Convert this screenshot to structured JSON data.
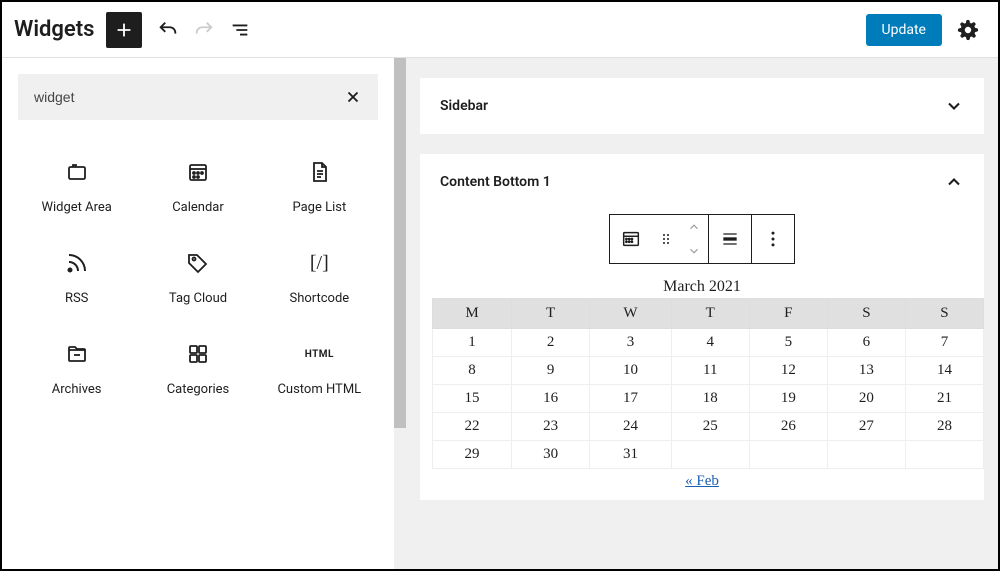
{
  "header": {
    "title": "Widgets",
    "update_label": "Update"
  },
  "search": {
    "value": "widget"
  },
  "blocks": [
    {
      "label": "Widget Area",
      "icon": "widget-area"
    },
    {
      "label": "Calendar",
      "icon": "calendar"
    },
    {
      "label": "Page List",
      "icon": "page-list"
    },
    {
      "label": "RSS",
      "icon": "rss"
    },
    {
      "label": "Tag Cloud",
      "icon": "tag"
    },
    {
      "label": "Shortcode",
      "icon": "shortcode"
    },
    {
      "label": "Archives",
      "icon": "archives"
    },
    {
      "label": "Categories",
      "icon": "categories"
    },
    {
      "label": "Custom HTML",
      "icon": "html"
    }
  ],
  "areas": {
    "sidebar": {
      "title": "Sidebar"
    },
    "content_bottom": {
      "title": "Content Bottom 1"
    }
  },
  "calendar": {
    "caption": "March 2021",
    "days": [
      "M",
      "T",
      "W",
      "T",
      "F",
      "S",
      "S"
    ],
    "weeks": [
      [
        "1",
        "2",
        "3",
        "4",
        "5",
        "6",
        "7"
      ],
      [
        "8",
        "9",
        "10",
        "11",
        "12",
        "13",
        "14"
      ],
      [
        "15",
        "16",
        "17",
        "18",
        "19",
        "20",
        "21"
      ],
      [
        "22",
        "23",
        "24",
        "25",
        "26",
        "27",
        "28"
      ],
      [
        "29",
        "30",
        "31",
        "",
        "",
        "",
        ""
      ]
    ],
    "prev_label": "« Feb"
  }
}
